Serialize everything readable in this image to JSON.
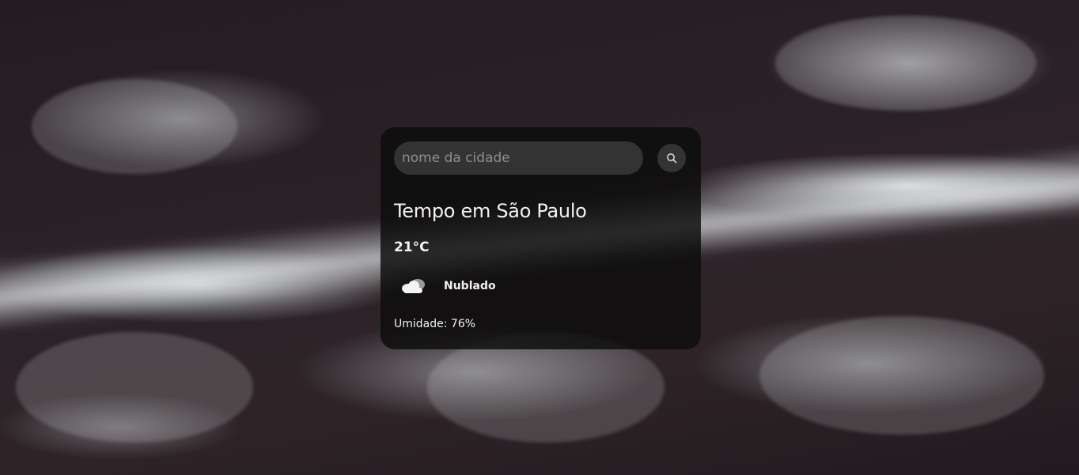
{
  "search": {
    "placeholder": "nome da cidade",
    "value": ""
  },
  "weather": {
    "title": "Tempo em São Paulo",
    "temperature": "21°C",
    "condition": "Nublado",
    "condition_icon": "cloud-icon",
    "humidity": "Umidade: 76%"
  },
  "icons": {
    "search_button": "search-icon"
  },
  "colors": {
    "card_background": "#0c0c0c",
    "text": "#f2f2f2",
    "input_background": "#5a5a5a"
  }
}
